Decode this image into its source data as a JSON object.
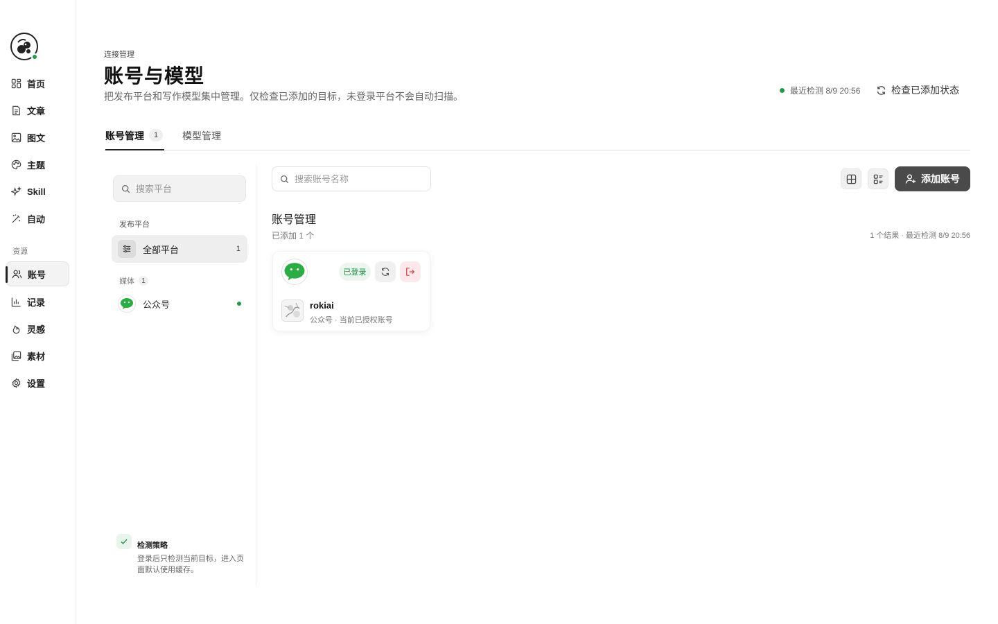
{
  "sidebar": {
    "items": [
      {
        "label": "首页",
        "icon": "grid-icon"
      },
      {
        "label": "文章",
        "icon": "document-icon"
      },
      {
        "label": "图文",
        "icon": "image-icon"
      },
      {
        "label": "主题",
        "icon": "palette-icon"
      },
      {
        "label": "Skill",
        "icon": "sparkles-icon"
      },
      {
        "label": "自动",
        "icon": "wand-icon"
      }
    ],
    "section_label": "资源",
    "resource_items": [
      {
        "label": "账号",
        "icon": "users-icon",
        "active": true
      },
      {
        "label": "记录",
        "icon": "bar-chart-icon"
      },
      {
        "label": "灵感",
        "icon": "flame-icon"
      },
      {
        "label": "素材",
        "icon": "images-icon"
      },
      {
        "label": "设置",
        "icon": "gear-icon"
      }
    ]
  },
  "header": {
    "eyebrow": "连接管理",
    "title": "账号与模型",
    "description": "把发布平台和写作模型集中管理。仅检查已添加的目标，未登录平台不会自动扫描。",
    "status_text": "最近检测 8/9 20:56",
    "check_button": "检查已添加状态"
  },
  "tabs": [
    {
      "label": "账号管理",
      "count": "1",
      "active": true
    },
    {
      "label": "模型管理"
    }
  ],
  "left_panel": {
    "search_placeholder": "搜索平台",
    "group_label": "发布平台",
    "all_platforms": {
      "label": "全部平台",
      "count": "1"
    },
    "media_label": "媒体",
    "media_count": "1",
    "platforms": [
      {
        "label": "公众号",
        "status": "connected"
      }
    ],
    "strategy": {
      "title": "检测策略",
      "description": "登录后只检测当前目标，进入页面默认使用缓存。"
    }
  },
  "main": {
    "search_placeholder": "搜索账号名称",
    "add_button": "添加账号",
    "section_title": "账号管理",
    "section_sub": "已添加 1 个",
    "results_text": "1 个结果 · 最近检测 8/9 20:56",
    "cards": [
      {
        "status": "已登录",
        "name": "rokiai",
        "description": "公众号 · 当前已授权账号"
      }
    ]
  },
  "colors": {
    "accent_green": "#1f9d45",
    "add_button_bg": "#4a4a4a",
    "logout_bg": "#fde9ea",
    "logout_icon": "#e0474f",
    "wechat_green": "#2aae43"
  }
}
